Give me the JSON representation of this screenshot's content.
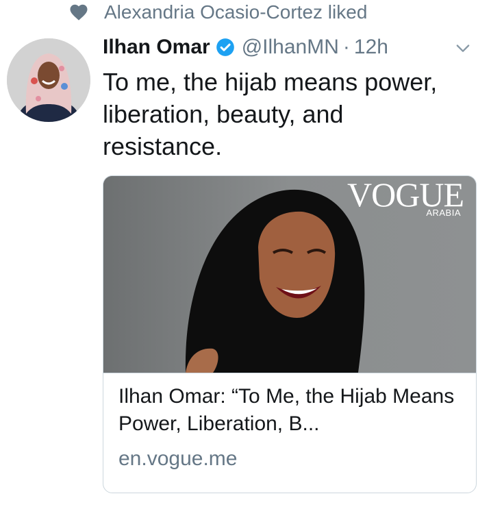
{
  "social_context": {
    "text": "Alexandria Ocasio-Cortez liked",
    "icon": "heart-icon"
  },
  "tweet": {
    "author_name": "Ilhan Omar",
    "handle": "@IlhanMN",
    "separator": "·",
    "time": "12h",
    "text": "To me, the hijab means power, liberation, beauty, and resistance.",
    "verified_icon": "verified-badge-icon",
    "menu_icon": "chevron-down-icon"
  },
  "card": {
    "logo_text": "VOGUE",
    "logo_subtext": "ARABIA",
    "title": "Ilhan Omar: “To Me, the Hijab Means Power, Liberation, B...",
    "domain": "en.vogue.me"
  },
  "colors": {
    "secondary_text": "#657786",
    "primary_text": "#14171a",
    "verified_blue": "#1da1f2",
    "border": "#ccd6dd"
  }
}
